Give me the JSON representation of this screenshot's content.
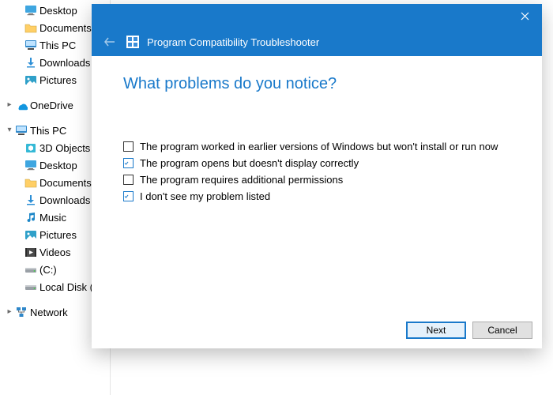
{
  "sidebar": {
    "items": [
      {
        "label": "Desktop",
        "icon": "desktop",
        "chev": null,
        "indent": 1
      },
      {
        "label": "Documents",
        "icon": "folder",
        "chev": null,
        "indent": 1
      },
      {
        "label": "This PC",
        "icon": "thispc",
        "chev": null,
        "indent": 1
      },
      {
        "label": "Downloads",
        "icon": "download",
        "chev": null,
        "indent": 1
      },
      {
        "label": "Pictures",
        "icon": "pictures",
        "chev": null,
        "indent": 1
      },
      {
        "label": "OneDrive",
        "icon": "onedrive",
        "chev": ">",
        "indent": 0,
        "gapBefore": 10
      },
      {
        "label": "This PC",
        "icon": "thispc",
        "chev": "v",
        "indent": 0,
        "gapBefore": 10
      },
      {
        "label": "3D Objects",
        "icon": "3d",
        "chev": null,
        "indent": 1
      },
      {
        "label": "Desktop",
        "icon": "desktop",
        "chev": null,
        "indent": 1
      },
      {
        "label": "Documents",
        "icon": "folder",
        "chev": null,
        "indent": 1
      },
      {
        "label": "Downloads",
        "icon": "download",
        "chev": null,
        "indent": 1
      },
      {
        "label": "Music",
        "icon": "music",
        "chev": null,
        "indent": 1
      },
      {
        "label": "Pictures",
        "icon": "pictures",
        "chev": null,
        "indent": 1
      },
      {
        "label": "Videos",
        "icon": "videos",
        "chev": null,
        "indent": 1
      },
      {
        "label": "(C:)",
        "icon": "drive",
        "chev": ">",
        "indent": 1
      },
      {
        "label": "Local Disk (D:)",
        "icon": "drive",
        "chev": null,
        "indent": 1
      },
      {
        "label": "Network",
        "icon": "network",
        "chev": ">",
        "indent": 0,
        "gapBefore": 10
      }
    ]
  },
  "dialog": {
    "title": "Program Compatibility Troubleshooter",
    "heading": "What problems do you notice?",
    "options": [
      {
        "label": "The program worked in earlier versions of Windows but won't install or run now",
        "checked": false
      },
      {
        "label": "The program opens but doesn't display correctly",
        "checked": true
      },
      {
        "label": "The program requires additional permissions",
        "checked": false
      },
      {
        "label": "I don't see my problem listed",
        "checked": true
      }
    ],
    "buttons": {
      "next": "Next",
      "cancel": "Cancel"
    }
  }
}
